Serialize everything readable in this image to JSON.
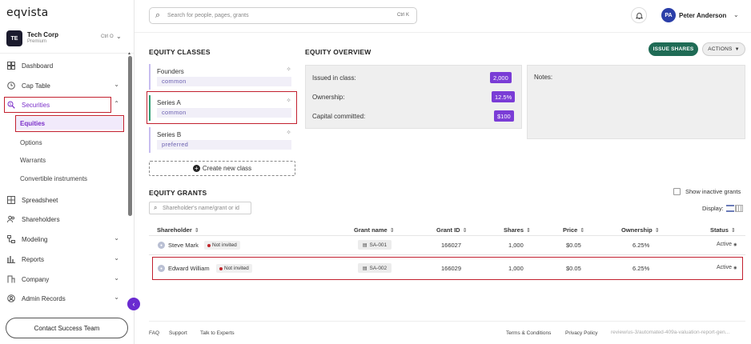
{
  "app": {
    "logo": "eqvista"
  },
  "company": {
    "initials": "TE",
    "name": "Tech Corp",
    "plan": "Premium",
    "shortcut": "Ctrl O"
  },
  "sidebar": {
    "items": [
      {
        "label": "Dashboard",
        "icon": "dashboard-icon"
      },
      {
        "label": "Cap Table",
        "icon": "clock-icon"
      },
      {
        "label": "Securities",
        "icon": "securities-icon"
      },
      {
        "label": "Equities"
      },
      {
        "label": "Options"
      },
      {
        "label": "Warrants"
      },
      {
        "label": "Convertible instruments"
      },
      {
        "label": "Spreadsheet",
        "icon": "grid-icon"
      },
      {
        "label": "Shareholders",
        "icon": "people-icon"
      },
      {
        "label": "Modeling",
        "icon": "modeling-icon"
      },
      {
        "label": "Reports",
        "icon": "chart-icon"
      },
      {
        "label": "Company",
        "icon": "company-icon"
      },
      {
        "label": "Admin Records",
        "icon": "records-icon"
      }
    ],
    "contact_label": "Contact Success Team"
  },
  "search": {
    "placeholder": "Search for people, pages, grants",
    "shortcut": "Ctrl K"
  },
  "user": {
    "initials": "PA",
    "name": "Peter Anderson"
  },
  "equity_classes": {
    "title": "EQUITY CLASSES",
    "classes": [
      {
        "name": "Founders",
        "type": "common"
      },
      {
        "name": "Series A",
        "type": "common"
      },
      {
        "name": "Series B",
        "type": "preferred"
      }
    ],
    "new_label": "Create new class"
  },
  "overview": {
    "title": "EQUITY OVERVIEW",
    "issued_label": "Issued in class:",
    "issued_value": "2,000",
    "ownership_label": "Ownership:",
    "ownership_value": "12.5%",
    "capital_label": "Capital committed:",
    "capital_value": "$100",
    "notes_label": "Notes:"
  },
  "actions": {
    "issue": "ISSUE SHARES",
    "actions": "ACTIONS"
  },
  "grants": {
    "title": "EQUITY GRANTS",
    "search_placeholder": "Shareholder's name/grant or id",
    "show_inactive": "Show inactive grants",
    "display_label": "Display:",
    "columns": [
      "Shareholder",
      "Grant name",
      "Grant ID",
      "Shares",
      "Price",
      "Ownership",
      "Status"
    ],
    "rows": [
      {
        "name": "Steve Mark",
        "invite": "Not invited",
        "grant": "SA-001",
        "id": "166027",
        "shares": "1,000",
        "price": "$0.05",
        "ownership": "6.25%",
        "status": "Active"
      },
      {
        "name": "Edward William",
        "invite": "Not invited",
        "grant": "SA-002",
        "id": "166029",
        "shares": "1,000",
        "price": "$0.05",
        "ownership": "6.25%",
        "status": "Active"
      }
    ]
  },
  "footer": {
    "links": [
      "FAQ",
      "Support",
      "Talk to Experts",
      "Terms & Conditions",
      "Privacy Policy"
    ],
    "path": "review/us-3/automated-409a-valuation-report-gen..."
  },
  "colors": {
    "accent": "#7b2fc9",
    "issue_button": "#1f6b55",
    "badge": "#7a3cd6",
    "highlight": "#c2202f"
  }
}
